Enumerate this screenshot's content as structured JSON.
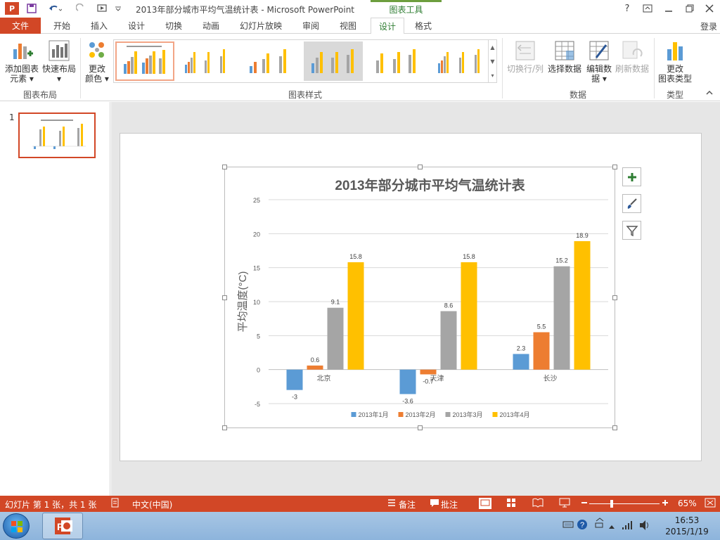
{
  "window": {
    "title": "2013年部分城市平均气温统计表 - Microsoft PowerPoint",
    "contextual_group": "图表工具",
    "help": "?",
    "login": "登录"
  },
  "tabs": {
    "file": "文件",
    "items": [
      "开始",
      "插入",
      "设计",
      "切换",
      "动画",
      "幻灯片放映",
      "审阅",
      "视图",
      "设计",
      "格式"
    ]
  },
  "ribbon": {
    "chart_layouts": {
      "add_element": "添加图表",
      "add_element_2": "元素",
      "quick_layout": "快速布局",
      "label": "图表布局"
    },
    "change_colors": {
      "line1": "更改",
      "line2": "颜色"
    },
    "styles_label": "图表样式",
    "data": {
      "switch_row_col": "切换行/列",
      "select_data": "选择数据",
      "edit_data": "编辑数",
      "edit_data_2": "据",
      "refresh_data": "刷新数据",
      "label": "数据"
    },
    "type": {
      "change_type": "更改",
      "change_type_2": "图表类型",
      "label": "类型"
    }
  },
  "thumbnails": {
    "slide_number": "1"
  },
  "statusbar": {
    "slide_info": "幻灯片 第 1 张，共 1 张",
    "language": "中文(中国)",
    "notes": "备注",
    "comments": "批注",
    "zoom": "65%"
  },
  "taskbar": {
    "time": "16:53",
    "date": "2015/1/19"
  },
  "colors": {
    "accent": "#d24726",
    "series": [
      "#5b9bd5",
      "#ed7d31",
      "#a5a5a5",
      "#ffc000"
    ]
  },
  "chart_data": {
    "type": "bar",
    "title": "2013年部分城市平均气温统计表",
    "ylabel": "平均温度(°C)",
    "xlabel": "",
    "categories": [
      "北京",
      "天津",
      "长沙"
    ],
    "series": [
      {
        "name": "2013年1月",
        "values": [
          -3,
          -3.6,
          2.3
        ]
      },
      {
        "name": "2013年2月",
        "values": [
          0.6,
          -0.7,
          5.5
        ]
      },
      {
        "name": "2013年3月",
        "values": [
          9.1,
          8.6,
          15.2
        ]
      },
      {
        "name": "2013年4月",
        "values": [
          15.8,
          15.8,
          18.9
        ]
      }
    ],
    "ylim": [
      -5,
      25
    ],
    "yticks": [
      -5,
      0,
      5,
      10,
      15,
      20,
      25
    ],
    "grid": true,
    "data_labels": true,
    "legend": "bottom"
  }
}
